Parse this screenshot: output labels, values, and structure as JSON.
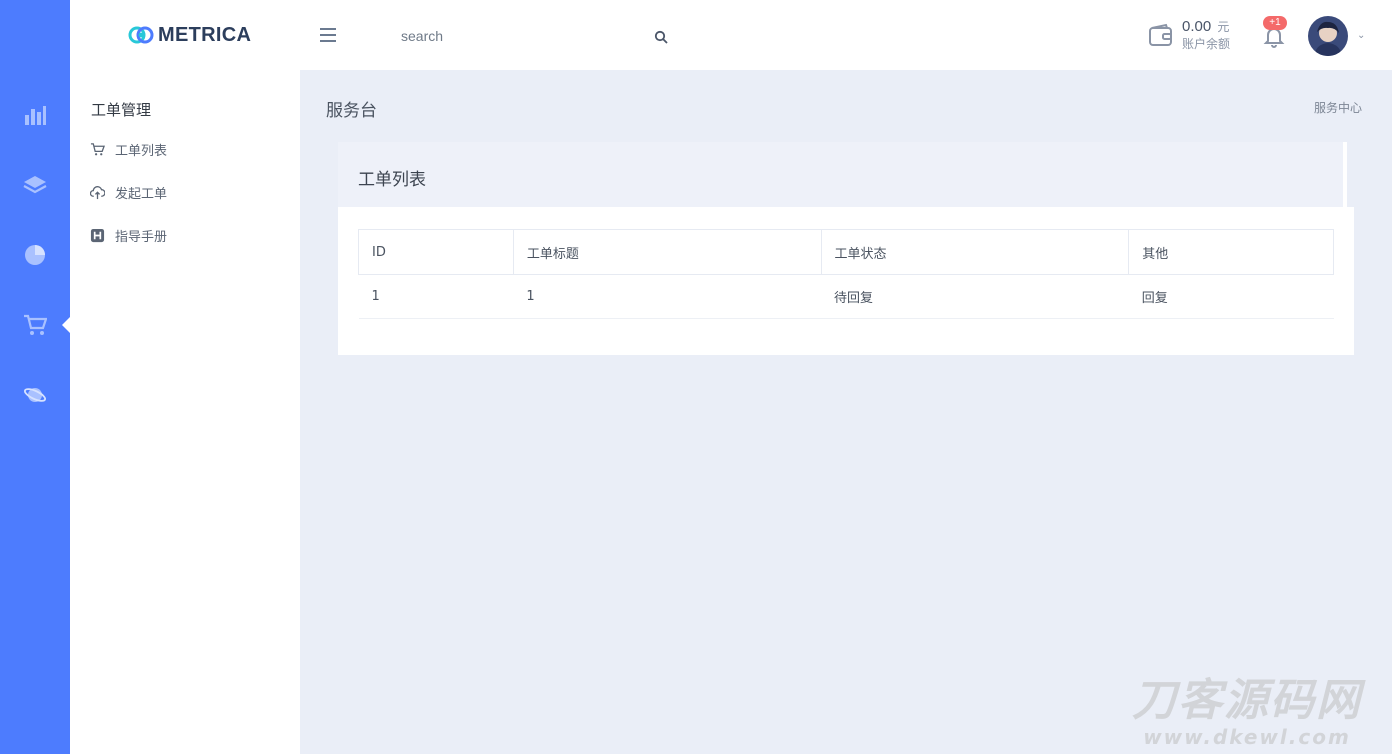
{
  "brand": {
    "name": "METRICA"
  },
  "header": {
    "search": {
      "placeholder": "search",
      "value": ""
    },
    "wallet": {
      "amount": "0.00",
      "unit": "元",
      "label": "账户余额"
    },
    "notifications": {
      "badge": "+1"
    }
  },
  "rail": {
    "items": [
      {
        "icon": "bar-chart-icon"
      },
      {
        "icon": "layers-icon"
      },
      {
        "icon": "pie-chart-icon"
      },
      {
        "icon": "shopping-cart-icon",
        "active": true
      },
      {
        "icon": "planet-icon"
      }
    ]
  },
  "subnav": {
    "title": "工单管理",
    "items": [
      {
        "label": "工单列表",
        "icon": "cart-icon"
      },
      {
        "label": "发起工单",
        "icon": "cloud-upload-icon"
      },
      {
        "label": "指导手册",
        "icon": "h-square-icon"
      }
    ]
  },
  "page": {
    "title": "服务台",
    "breadcrumb": "服务中心"
  },
  "card": {
    "title": "工单列表",
    "table": {
      "columns": [
        "ID",
        "工单标题",
        "工单状态",
        "其他"
      ],
      "rows": [
        {
          "id": "1",
          "title": "1",
          "status": "待回复",
          "action": "回复"
        }
      ]
    }
  },
  "watermark": {
    "main": "刀客源码网",
    "sub": "www.dkewl.com"
  },
  "colors": {
    "rail": "#4d7cfe",
    "background": "#eaeef7",
    "badge": "#f46a6a"
  }
}
